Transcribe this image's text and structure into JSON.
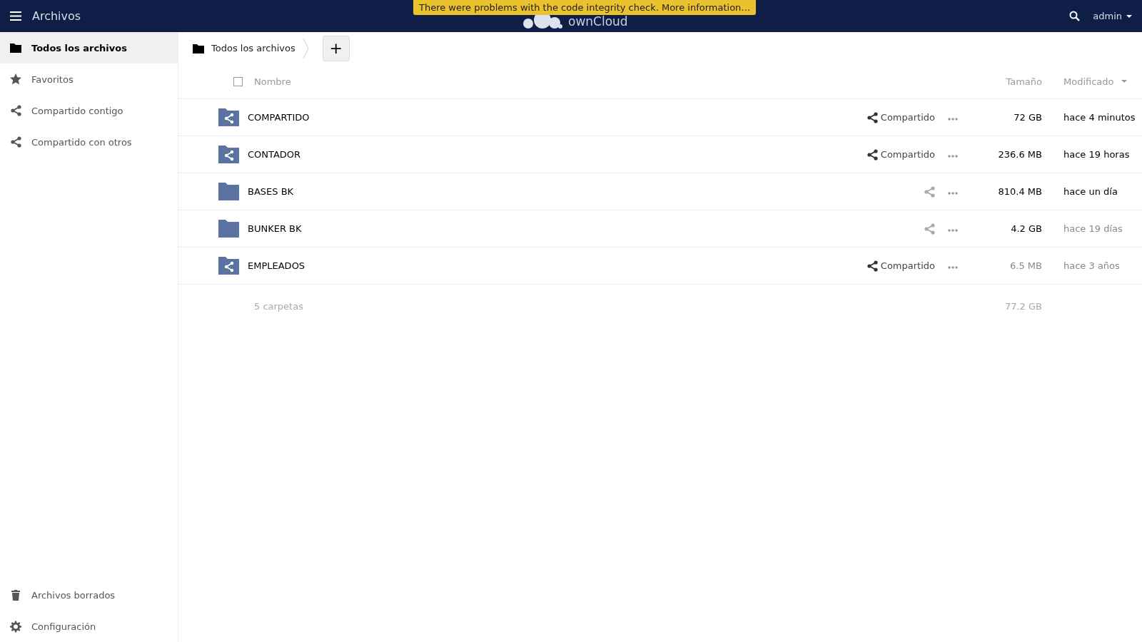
{
  "header": {
    "app_title": "Archivos",
    "logo_text": "ownCloud",
    "banner": "There were problems with the code integrity check. More information…",
    "user": "admin"
  },
  "sidebar": {
    "items": [
      {
        "label": "Todos los archivos",
        "selected": true
      },
      {
        "label": "Favoritos",
        "selected": false
      },
      {
        "label": "Compartido contigo",
        "selected": false
      },
      {
        "label": "Compartido con otros",
        "selected": false
      }
    ],
    "bottom_items": [
      {
        "label": "Archivos borrados"
      },
      {
        "label": "Configuración"
      }
    ]
  },
  "breadcrumb": {
    "label": "Todos los archivos",
    "new_button": "+"
  },
  "table": {
    "columns": {
      "name": "Nombre",
      "size": "Tamaño",
      "modified": "Modificado"
    },
    "select_all_checked": false,
    "rows": [
      {
        "name": "COMPARTIDO",
        "shared": true,
        "share_label": "Compartido",
        "size": "72 GB",
        "size_faded": false,
        "modified": "hace 4 minutos",
        "date_dimmed": false
      },
      {
        "name": "CONTADOR",
        "shared": true,
        "share_label": "Compartido",
        "size": "236.6 MB",
        "size_faded": false,
        "modified": "hace 19 horas",
        "date_dimmed": false
      },
      {
        "name": "BASES BK",
        "shared": false,
        "size": "810.4 MB",
        "size_faded": false,
        "modified": "hace un día",
        "date_dimmed": false
      },
      {
        "name": "BUNKER BK",
        "shared": false,
        "size": "4.2 GB",
        "size_faded": false,
        "modified": "hace 19 días",
        "date_dimmed": true
      },
      {
        "name": "EMPLEADOS",
        "shared": true,
        "share_label": "Compartido",
        "size": "6.5 MB",
        "size_faded": true,
        "modified": "hace 3 años",
        "date_dimmed": true
      }
    ],
    "summary": {
      "count": "5 carpetas",
      "total": "77.2 GB"
    }
  }
}
